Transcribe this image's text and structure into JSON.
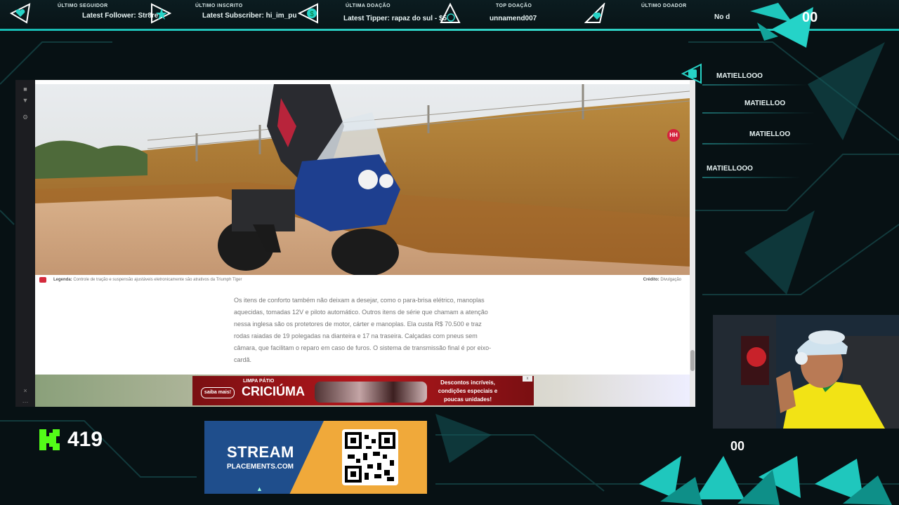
{
  "topbar": {
    "slots": [
      {
        "title": "Último Seguidor",
        "value": "Latest Follower: Str8re",
        "icon": "heart-icon"
      },
      {
        "title": "Último Inscrito",
        "value": "Latest Subscriber: hi_im_pu",
        "icon": "star-icon"
      },
      {
        "title": "Última Doação",
        "value": "Latest Tipper: rapaz do sul - $5",
        "icon": "dollar-icon"
      },
      {
        "title": "Top Doação",
        "value": "unnamend007",
        "icon": "money-bag-icon"
      },
      {
        "title": "Último Doador",
        "value": "No d",
        "icon": "diamond-icon"
      }
    ],
    "right_count": "00"
  },
  "browser": {
    "caption": {
      "legend_label": "Legenda:",
      "legend_text": "Controle de tração e suspensão ajustáveis eletronicamente são atrativos da Triumph Tiger",
      "credit_label": "Crédito:",
      "credit_text": "Divulgação"
    },
    "article_text": "Os itens de conforto também não deixam a desejar, como o para-brisa elétrico, manoplas aquecidas, tomadas 12V e piloto automático. Outros itens de série que chamam a atenção nessa inglesa são os protetores de motor, cárter e manoplas. Ela custa R$ 70.500 e traz rodas raiadas de 19 polegadas na dianteira e 17 na traseira. Calçadas com pneus sem câmara, que facilitam o reparo em caso de furos. O sistema de transmissão final é por eixo-cardã.",
    "ad": {
      "left_button": "saiba mais!",
      "headline_small": "LIMPA PÁTIO",
      "headline": "CRICIÚMA",
      "right_text": "Descontos incríveis, condições especiais e poucas unidades!"
    },
    "badge": "HH"
  },
  "chat": {
    "names": [
      "MATIELLOOO",
      "MATIELLOO",
      "MATIELLOO",
      "MATIELLOOO"
    ]
  },
  "counters": {
    "kick_count": "419",
    "right_count": "00"
  },
  "sponsor": {
    "title": "STREAM",
    "subtitle": "PLACEMENTS.COM"
  },
  "colors": {
    "accent": "#1fc7bd",
    "background": "#071114"
  }
}
